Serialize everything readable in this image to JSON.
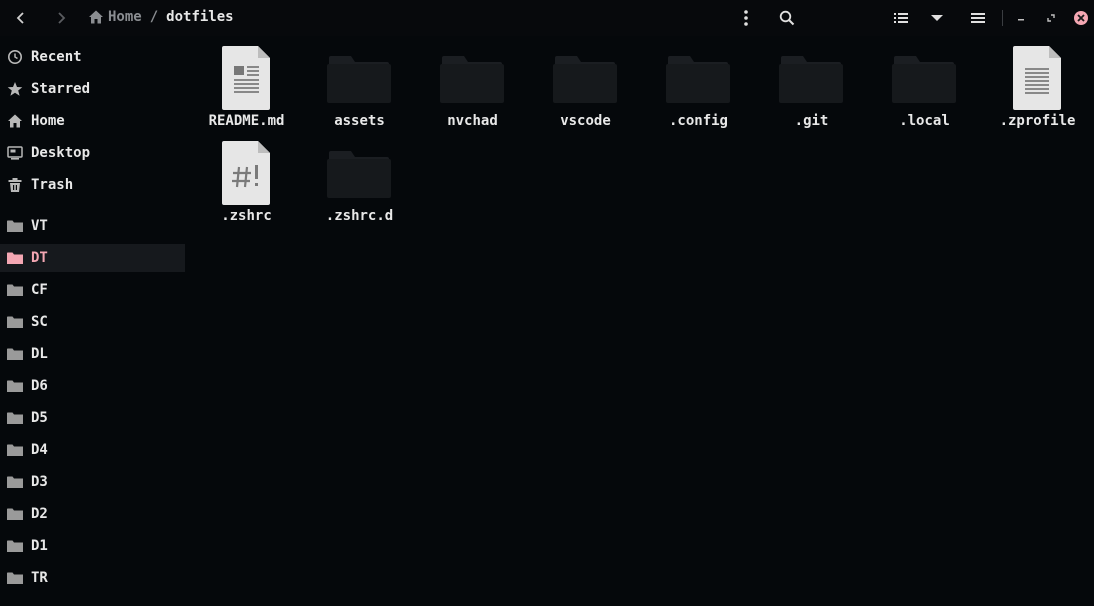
{
  "window": {
    "breadcrumb": {
      "home_label": "Home",
      "separator": "/",
      "current": "dotfiles"
    }
  },
  "sidebar": {
    "places": [
      {
        "label": "Recent",
        "icon": "clock-icon"
      },
      {
        "label": "Starred",
        "icon": "star-icon"
      },
      {
        "label": "Home",
        "icon": "home-icon"
      },
      {
        "label": "Desktop",
        "icon": "desktop-icon"
      },
      {
        "label": "Trash",
        "icon": "trash-icon"
      }
    ],
    "bookmarks": [
      {
        "label": "VT"
      },
      {
        "label": "DT",
        "active": true
      },
      {
        "label": "CF"
      },
      {
        "label": "SC"
      },
      {
        "label": "DL"
      },
      {
        "label": "D6"
      },
      {
        "label": "D5"
      },
      {
        "label": "D4"
      },
      {
        "label": "D3"
      },
      {
        "label": "D2"
      },
      {
        "label": "D1"
      },
      {
        "label": "TR"
      }
    ]
  },
  "files": [
    {
      "name": "README.md",
      "type": "text-document"
    },
    {
      "name": "assets",
      "type": "folder"
    },
    {
      "name": "nvchad",
      "type": "folder"
    },
    {
      "name": "vscode",
      "type": "folder"
    },
    {
      "name": ".config",
      "type": "folder"
    },
    {
      "name": ".git",
      "type": "folder"
    },
    {
      "name": ".local",
      "type": "folder"
    },
    {
      "name": ".zprofile",
      "type": "text-file"
    },
    {
      "name": ".zshrc",
      "type": "script-file"
    },
    {
      "name": ".zshrc.d",
      "type": "folder"
    }
  ],
  "colors": {
    "background": "#05080b",
    "active_accent": "#f4a7b3",
    "close_button": "#f4a7b3",
    "folder": "#16191c"
  }
}
